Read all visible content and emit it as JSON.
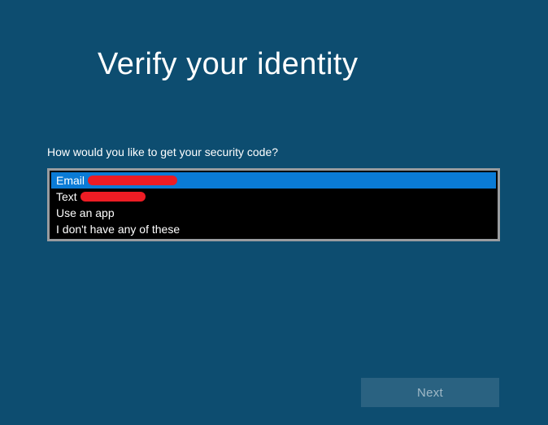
{
  "title": "Verify your identity",
  "prompt": "How would you like to get your security code?",
  "options": {
    "0": {
      "label": "Email",
      "redacted": true
    },
    "1": {
      "label": "Text",
      "redacted": true
    },
    "2": {
      "label": "Use an app",
      "redacted": false
    },
    "3": {
      "label": "I don't have any of these",
      "redacted": false
    }
  },
  "buttons": {
    "next": "Next"
  }
}
